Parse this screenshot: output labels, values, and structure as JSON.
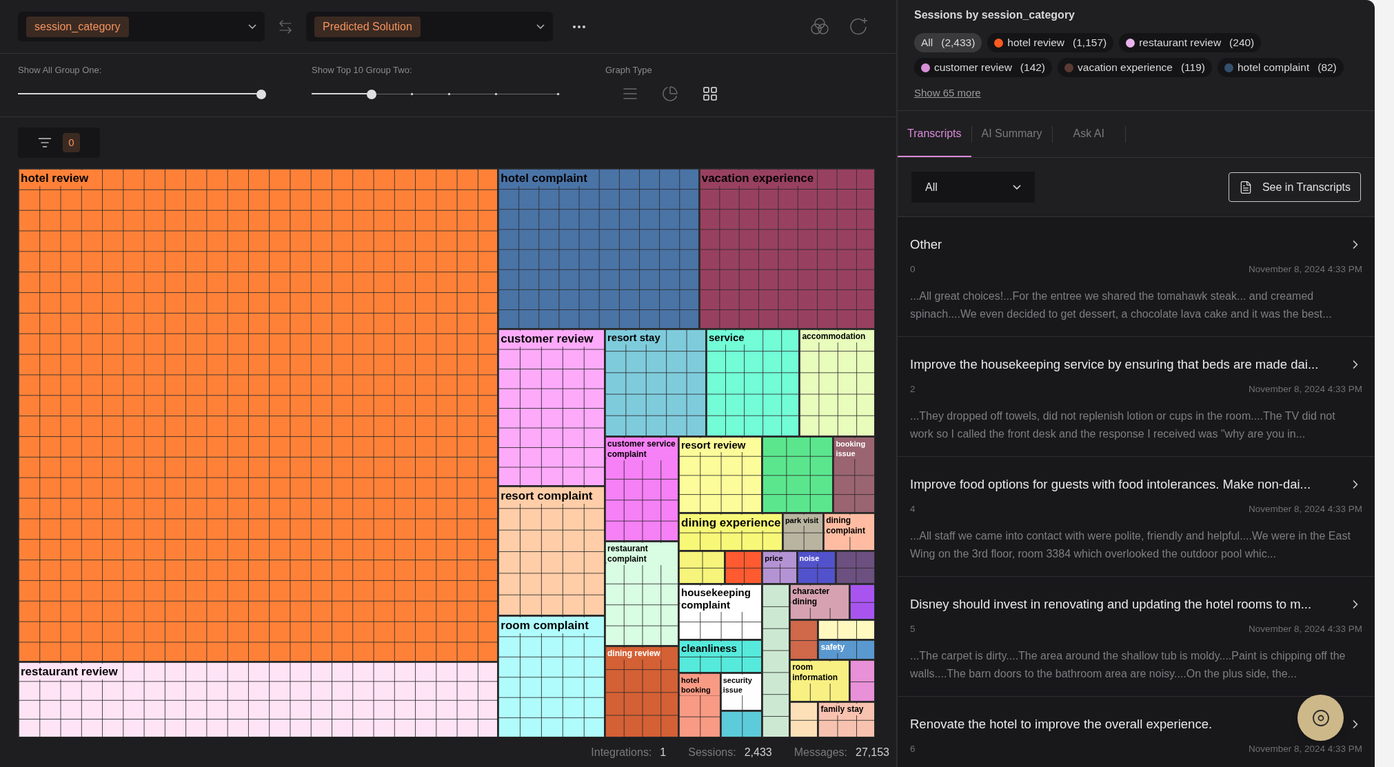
{
  "toolbar": {
    "group_one": {
      "value": "session_category"
    },
    "group_two": {
      "value": "Predicted Solution"
    }
  },
  "controls": {
    "group_one_slider": {
      "label": "Show All Group One:",
      "level": 1
    },
    "group_two_slider": {
      "label": "Show Top 10 Group Two:",
      "level": 0.23
    },
    "graph_type": {
      "label": "Graph Type",
      "options": [
        {
          "kind": "list",
          "selected": false
        },
        {
          "kind": "pie",
          "selected": false
        },
        {
          "kind": "grid",
          "selected": true
        }
      ]
    }
  },
  "filter": {
    "count": "0"
  },
  "treemap": {
    "tiles": [
      {
        "label": "hotel review",
        "color": "#ff8138"
      },
      {
        "label": "restaurant review",
        "color": "#ffe4f6"
      },
      {
        "label": "hotel complaint",
        "color": "#4a73a6"
      },
      {
        "label": "vacation experience",
        "color": "#984060"
      },
      {
        "label": "customer review",
        "color": "#fdaafa"
      },
      {
        "label": "resort complaint",
        "color": "#ffcda8"
      },
      {
        "label": "room complaint",
        "color": "#b0fcfc"
      },
      {
        "label": "resort stay",
        "color": "#7ecbdc"
      },
      {
        "label": "service",
        "color": "#72fdd6"
      },
      {
        "label": "accommodation",
        "color": "#e8fcbc"
      },
      {
        "label": "customer service complaint",
        "color": "#f680f6"
      },
      {
        "label": "restaurant complaint",
        "color": "#d8fde2"
      },
      {
        "label": "dining review",
        "color": "#d46035"
      },
      {
        "label": "resort review",
        "color": "#fdfc9a"
      },
      {
        "color": "#5be68e"
      },
      {
        "label": "booking issue",
        "color": "#9a6470"
      },
      {
        "label": "dining experience",
        "color": "#f8f878"
      },
      {
        "label": "park visit",
        "color": "#b8b4a0"
      },
      {
        "label": "dining complaint",
        "color": "#ffbca2"
      },
      {
        "label": "price",
        "color": "#b493d4"
      },
      {
        "label": "noise",
        "color": "#5252cc"
      },
      {
        "color": "#6c5080"
      },
      {
        "color": "#f6f47a"
      },
      {
        "label": "housekeeping complaint",
        "color": "#ffffff"
      },
      {
        "color": "#ff5a30"
      },
      {
        "label": "cleanliness",
        "color": "#55eadc"
      },
      {
        "label": "hotel booking",
        "color": "#f99a84"
      },
      {
        "label": "security issue",
        "color": "#fefefe"
      },
      {
        "color": "#5ccbda"
      },
      {
        "color": "#cde8d2"
      },
      {
        "label": "character dining",
        "color": "#d6a2b2"
      },
      {
        "color": "#a855f0"
      },
      {
        "color": "#d0684a"
      },
      {
        "color": "#fff9c0"
      },
      {
        "label": "safety",
        "color": "#5a98d0"
      },
      {
        "label": "room information",
        "color": "#f8f082"
      },
      {
        "color": "#e890d8"
      },
      {
        "label": "family stay",
        "color": "#f8c2b0"
      },
      {
        "color": "#fde0b8"
      }
    ]
  },
  "footer": [
    {
      "label": "Integrations:",
      "value": "1"
    },
    {
      "label": "Sessions:",
      "value": "2,433"
    },
    {
      "label": "Messages:",
      "value": "27,153"
    }
  ],
  "sidebar": {
    "title": "Sessions by session_category",
    "chips": [
      {
        "label": "All",
        "count": "(2,433)",
        "selected": true
      },
      {
        "label": "hotel review",
        "count": "(1,157)",
        "color": "#ff5a1f",
        "selected": false
      },
      {
        "label": "restaurant review",
        "count": "(240)",
        "color": "#e8b3ec",
        "selected": false
      },
      {
        "label": "customer review",
        "count": "(142)",
        "color": "#d68fd8",
        "selected": false
      },
      {
        "label": "vacation experience",
        "count": "(119)",
        "color": "#5b3a34",
        "selected": false
      },
      {
        "label": "hotel complaint",
        "count": "(82)",
        "color": "#34506e",
        "selected": false
      }
    ],
    "show_more": "Show 65 more",
    "tabs": [
      {
        "label": "Transcripts",
        "selected": true
      },
      {
        "label": "AI Summary",
        "selected": false
      },
      {
        "label": "Ask AI",
        "selected": false
      }
    ],
    "filter": {
      "value": "All"
    },
    "see_button": "See in Transcripts",
    "transcripts": [
      {
        "title": "Other",
        "number": "0",
        "date": "November 8, 2024 4:33 PM",
        "snippet": "...All great choices!...For the entree we shared the tomahawk steak... and creamed spinach....We even decided to get dessert, a chocolate lava cake and it was the best..."
      },
      {
        "title": "Improve the housekeeping service by ensuring that beds are made dai...",
        "number": "2",
        "date": "November 8, 2024 4:33 PM",
        "snippet": "...They dropped off towels, did not replenish lotion or cups in the room....The TV did not work so I called the front desk and the response I received was \"why are you in..."
      },
      {
        "title": "Improve food options for guests with food intolerances. Make non-dai...",
        "number": "4",
        "date": "November 8, 2024 4:33 PM",
        "snippet": "...All staff we came into contact with were polite, friendly and helpful....We were in the East Wing on the 3rd floor, room 3384 which overlooked the outdoor pool whic..."
      },
      {
        "title": "Disney should invest in renovating and updating the hotel rooms to m...",
        "number": "5",
        "date": "November 8, 2024 4:33 PM",
        "snippet": "...The carpet is dirty....The area around the shallow tub is moldy....Paint is chipping off the walls....The barn doors to the bathroom area are noisy....On the plus side, the..."
      },
      {
        "title": "Renovate the hotel to improve the overall experience.",
        "number": "6",
        "date": "November 8, 2024 4:33 PM"
      }
    ]
  }
}
